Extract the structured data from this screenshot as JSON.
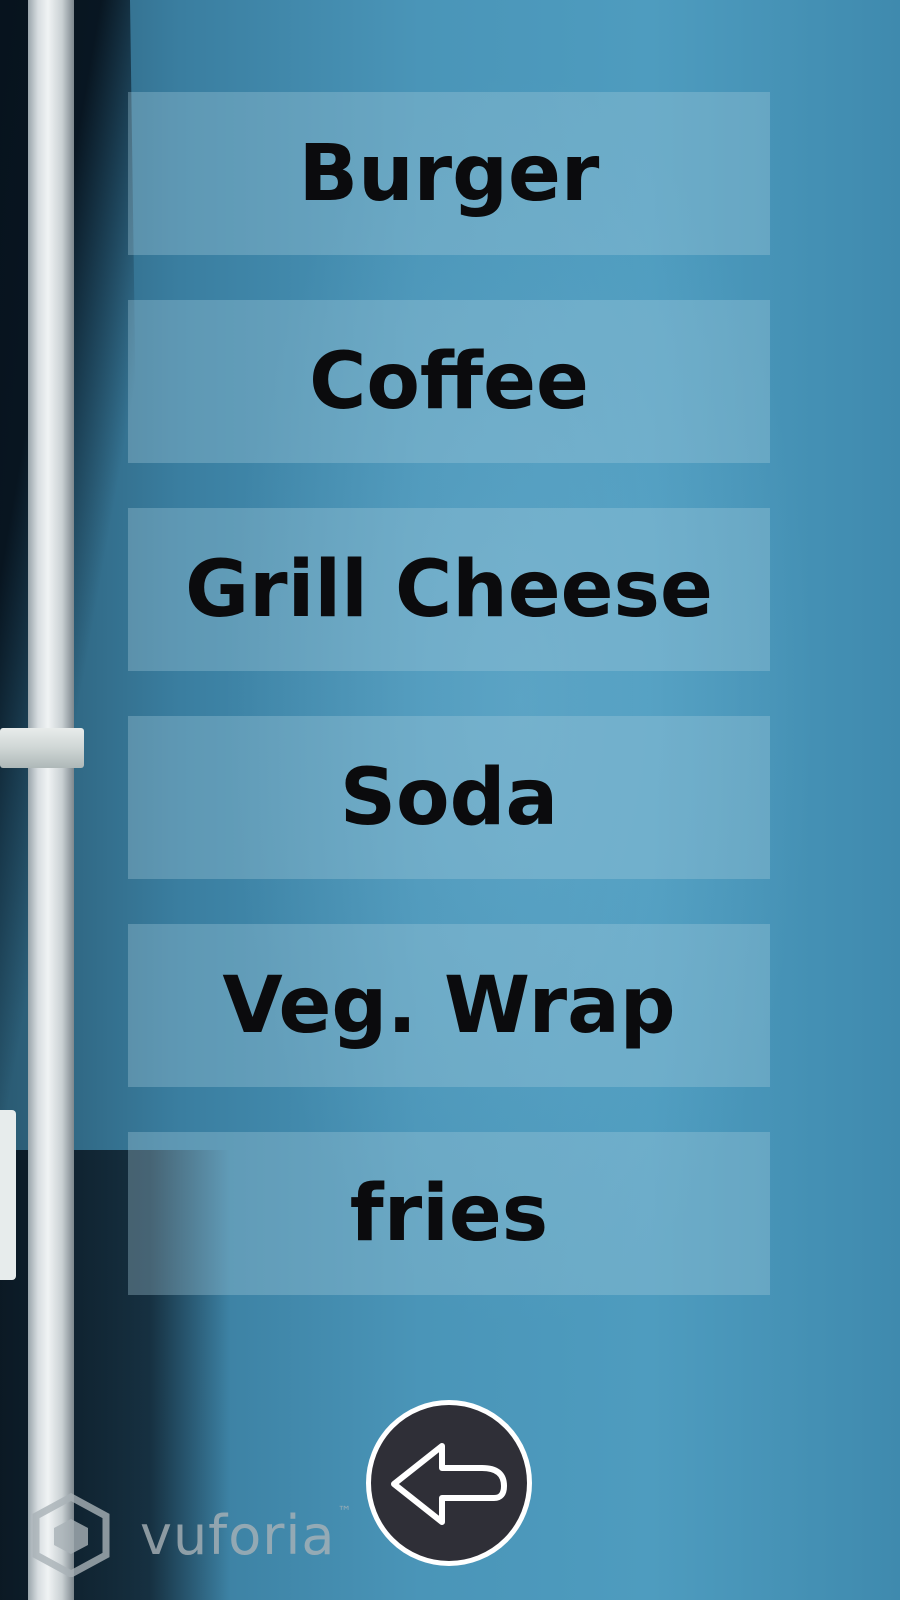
{
  "menu": {
    "items": [
      {
        "label": "Burger"
      },
      {
        "label": "Coffee"
      },
      {
        "label": "Grill Cheese"
      },
      {
        "label": "Soda"
      },
      {
        "label": "Veg. Wrap"
      },
      {
        "label": "fries"
      }
    ]
  },
  "back_button": {
    "icon": "back-arrow-icon"
  },
  "branding": {
    "logo_text": "vuforia",
    "trademark": "™",
    "icon": "vuforia-cube-icon"
  },
  "colors": {
    "background": "#4a95b8",
    "menu_item_bg": "rgba(170,205,222,0.33)",
    "label_text": "#0b0b0d",
    "button_bg": "#2f2f37",
    "button_border": "#ffffff"
  }
}
